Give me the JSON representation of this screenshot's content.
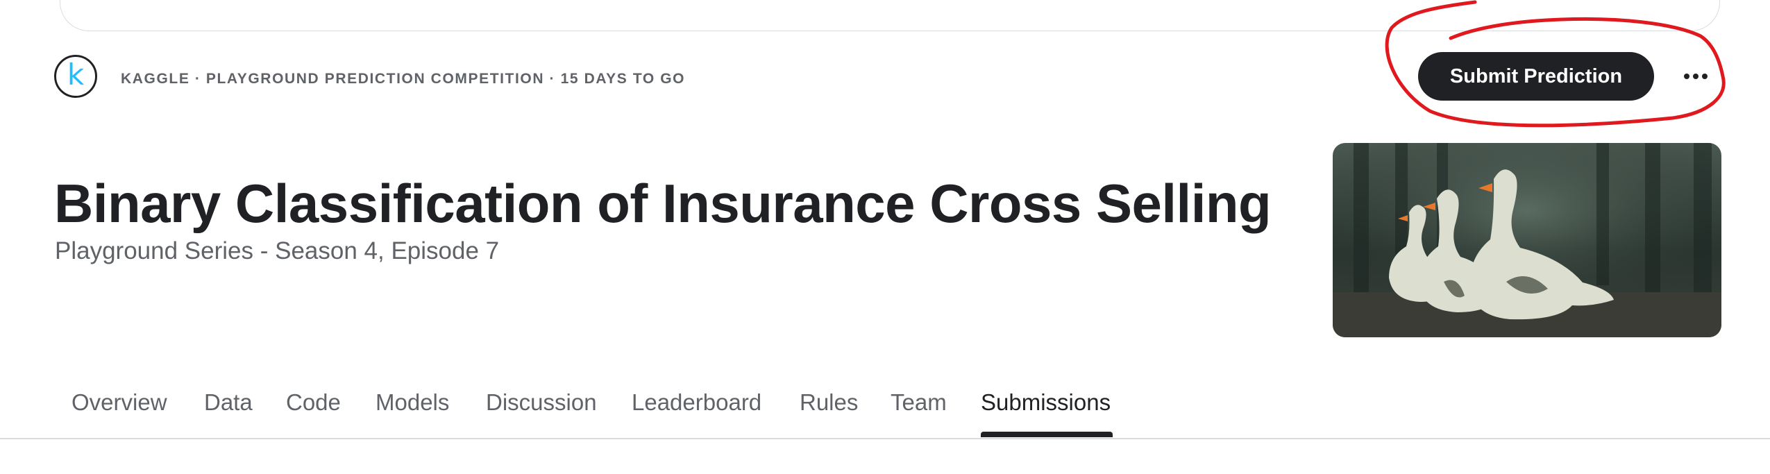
{
  "host": {
    "logo_letter": "k",
    "meta_text": "KAGGLE · PLAYGROUND PREDICTION COMPETITION · 15 DAYS TO GO"
  },
  "actions": {
    "submit_label": "Submit Prediction",
    "more_icon": "more-horizontal-icon"
  },
  "competition": {
    "title": "Binary Classification of Insurance Cross Selling",
    "subtitle": "Playground Series - Season 4, Episode 7",
    "header_image": "geese-illustration"
  },
  "tabs": [
    {
      "label": "Overview"
    },
    {
      "label": "Data"
    },
    {
      "label": "Code"
    },
    {
      "label": "Models"
    },
    {
      "label": "Discussion"
    },
    {
      "label": "Leaderboard"
    },
    {
      "label": "Rules"
    },
    {
      "label": "Team"
    },
    {
      "label": "Submissions",
      "active": true
    }
  ],
  "colors": {
    "primary_button": "#202124",
    "kaggle_blue": "#20beff",
    "annotation_red": "#e0191f",
    "muted_text": "#5f6368",
    "divider": "#dadce0"
  }
}
